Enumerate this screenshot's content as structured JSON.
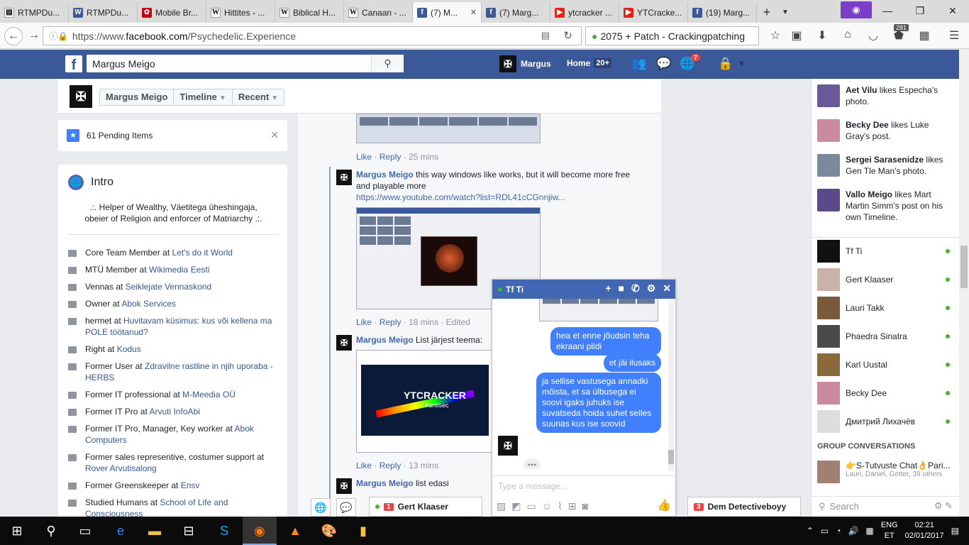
{
  "browser": {
    "tabs": [
      {
        "title": "RTMPDu...",
        "icon": "document-icon"
      },
      {
        "title": "RTMPDu...",
        "icon": "wordpress-icon"
      },
      {
        "title": "Mobile Br...",
        "icon": "huawei-icon"
      },
      {
        "title": "Hittites - ...",
        "icon": "wikipedia-icon"
      },
      {
        "title": "Biblical H...",
        "icon": "wikipedia-icon"
      },
      {
        "title": "Canaan - ...",
        "icon": "wikipedia-icon"
      },
      {
        "title": "(7) M...",
        "icon": "facebook-icon"
      },
      {
        "title": "(7) Marg...",
        "icon": "facebook-icon"
      },
      {
        "title": "ytcracker ...",
        "icon": "youtube-icon"
      },
      {
        "title": "YTCracke...",
        "icon": "youtube-icon"
      },
      {
        "title": "(19) Marg...",
        "icon": "facebook-icon"
      }
    ],
    "url_prefix": "https://www.",
    "url_domain": "facebook.com",
    "url_path": "/Psychedelic.Experience",
    "search_text": "2075 + Patch - Crackingpatching",
    "badge": "281"
  },
  "fb": {
    "search_value": "Margus Meigo",
    "user_name": "Margus",
    "home_label": "Home",
    "home_count": "20+",
    "notif_count": "7"
  },
  "page": {
    "name_btn": "Margus Meigo",
    "timeline_btn": "Timeline",
    "recent_btn": "Recent",
    "pending": "61 Pending Items"
  },
  "intro": {
    "title": "Intro",
    "bio": ".:. Helper of Wealthy, Väetitega üheshingaja, obeier of Religion and enforcer of Matriarchy .:.",
    "items": [
      {
        "pre": "Core Team Member at ",
        "link": "Let's do it World"
      },
      {
        "pre": "MTÜ Member at ",
        "link": "Wikimedia Eesti"
      },
      {
        "pre": "Vennas at ",
        "link": "Seiklejate Vennaskond"
      },
      {
        "pre": "Owner at ",
        "link": "Abok Services"
      },
      {
        "pre": "hermet at ",
        "link": "Huvitavam küsimus: kus või kellena ma POLE töötanud?"
      },
      {
        "pre": "Right at ",
        "link": "Kodus"
      },
      {
        "pre": "Former User at ",
        "link": "Zdravilne rastline in njih uporaba - HERBS"
      },
      {
        "pre": "Former IT professional at ",
        "link": "M-Meedia OÜ"
      },
      {
        "pre": "Former IT Pro at ",
        "link": "Arvuti InfoAbi"
      },
      {
        "pre": "Former IT Pro, Manager, Key worker at ",
        "link": "Abok Computers"
      },
      {
        "pre": "Former sales representive, costumer support at ",
        "link": "Rover Arvutisalong"
      },
      {
        "pre": "Former Greenskeeper at ",
        "link": "Ensv"
      },
      {
        "pre": "Studied Humans at ",
        "link": "School of Life and Consciousness"
      }
    ]
  },
  "feed": {
    "like": "Like",
    "reply": "Reply",
    "dot": "·",
    "c1_time": "25 mins",
    "c2_name": "Margus Meigo",
    "c2_text": " this way windows like works, but it will become more free and playable more",
    "c2_link": "https://www.youtube.com/watch?list=RDL41cCGnnjiw...",
    "c2_time": "18 mins",
    "c2_edited": "Edited",
    "c3_name": "Margus Meigo",
    "c3_text": " List järjest teema:",
    "c3_time": "13 mins",
    "c4_name": "Margus Meigo",
    "c4_text": " list edasi",
    "video_title": "YTCRACKER",
    "video_sub": "#antisec"
  },
  "ticker": [
    {
      "name": "Aet Vilu",
      "rest": " likes Especha's photo.",
      "color": "#6a5a9a"
    },
    {
      "name": "Becky Dee",
      "rest": " likes Luke Gray's post.",
      "color": "#c98aa0"
    },
    {
      "name": "Sergei Sarasenidze",
      "rest": " likes Gen Tle Man's photo.",
      "color": "#7a8a9a"
    },
    {
      "name": "Vallo Meigo",
      "rest": " likes Mart Martin Simm's post on his own Timeline.",
      "color": "#5a4a8a"
    }
  ],
  "friends": [
    {
      "name": "Tf Ti",
      "color": "#111111"
    },
    {
      "name": "Gert Klaaser",
      "color": "#c9b3a8"
    },
    {
      "name": "Lauri Takk",
      "color": "#7a5a3a"
    },
    {
      "name": "Phaedra Sinatra",
      "color": "#4a4a4a"
    },
    {
      "name": "Karl Uustal",
      "color": "#8a6a3a"
    },
    {
      "name": "Becky Dee",
      "color": "#c98aa0"
    },
    {
      "name": "Дмитрий Лихачёв",
      "color": "#dddddd"
    }
  ],
  "group": {
    "head": "GROUP CONVERSATIONS",
    "title": "👉S-Tutvuste Chat👌Pari...",
    "sub": "Lauri, Daniel, Getter, 39 others"
  },
  "chat_search": "Search",
  "chat": {
    "name": "Tf Ti",
    "messages": [
      "hea et enne jõudsin teha ekraani pildi",
      "et jäi ilusaks",
      "ja sellise vastusega annadki mõista, et sa ülbusega ei soovi igaks juhuks ise suvatseda hoida suhet selles suunas kus ise soovid"
    ],
    "placeholder": "Type a message..."
  },
  "dock": {
    "gert_name": "Gert Klaaser",
    "gert_count": "1",
    "demon_name": "Dem Detectiveboyy",
    "demon_count": "3"
  },
  "tray": {
    "lang1": "ENG",
    "lang2": "ET",
    "time": "02:21",
    "date": "02/01/2017"
  }
}
